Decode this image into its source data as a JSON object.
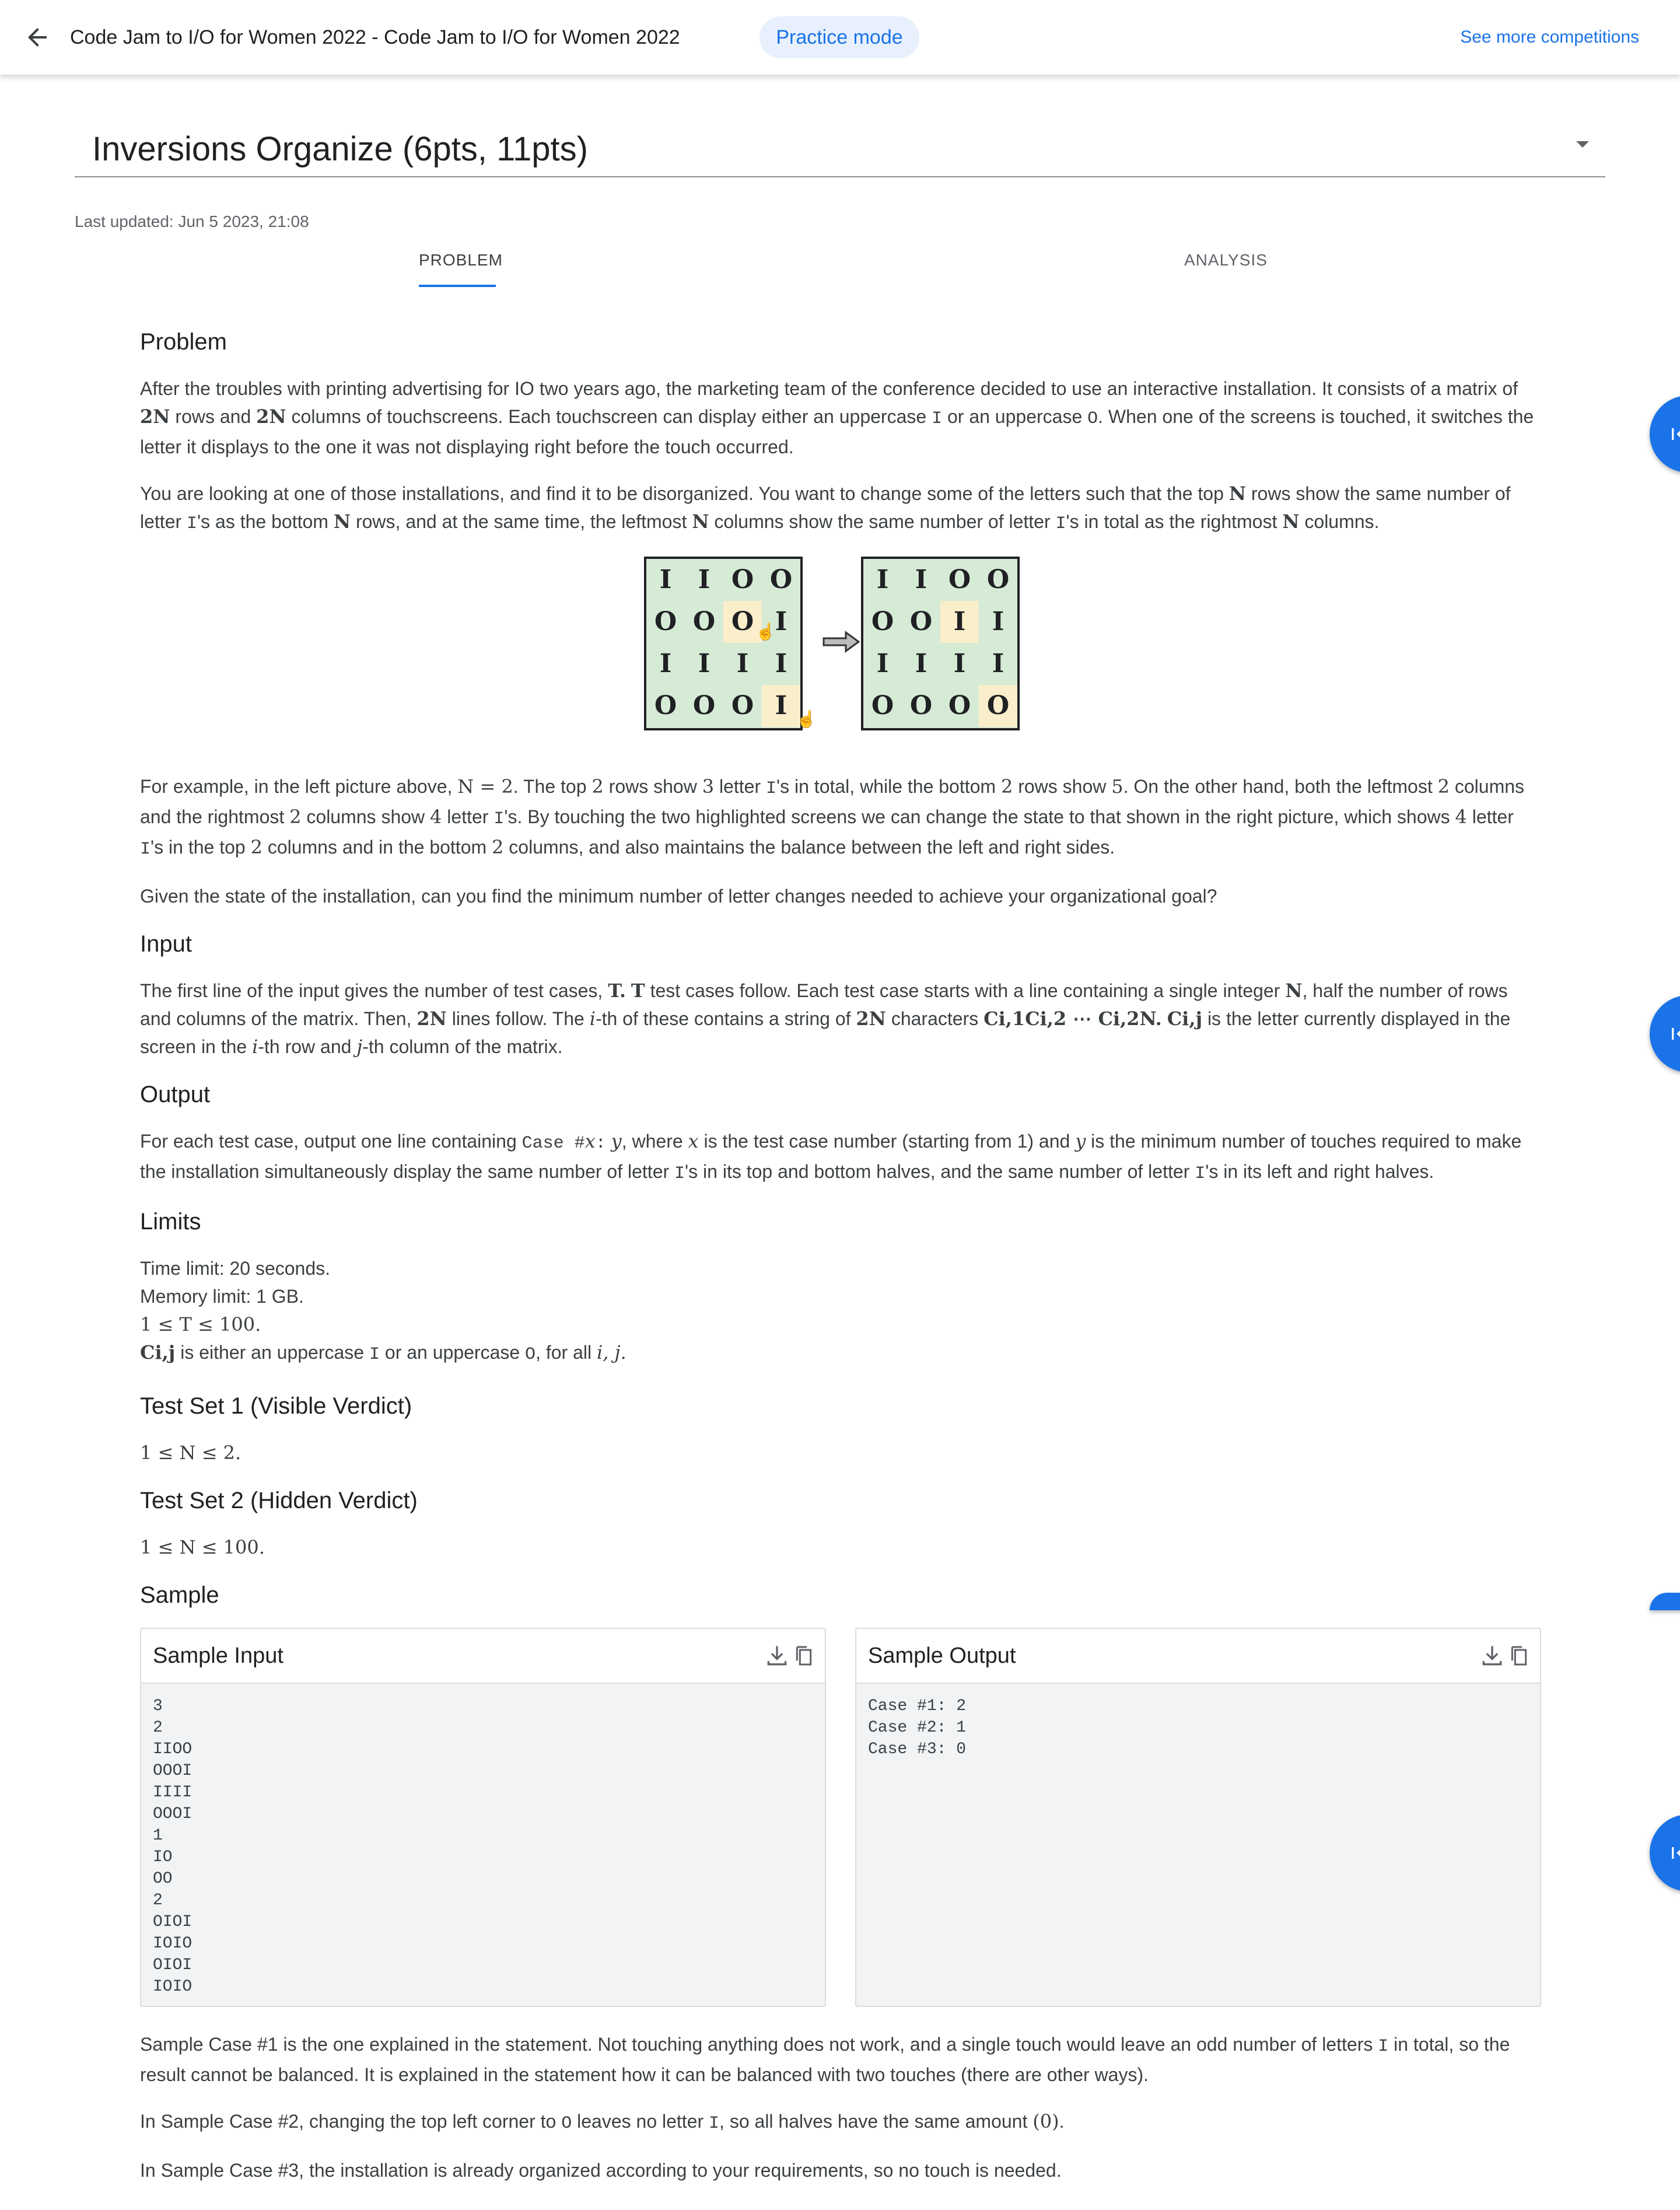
{
  "topbar": {
    "title": "Code Jam to I/O for Women 2022 - Code Jam to I/O for Women 2022",
    "mode_pill": "Practice mode",
    "see_more": "See more competitions"
  },
  "problem_selector": {
    "value": "Inversions Organize (6pts, 11pts)"
  },
  "last_updated": "Last updated: Jun 5 2023, 21:08",
  "tabs": [
    {
      "label": "PROBLEM",
      "active": true
    },
    {
      "label": "ANALYSIS",
      "active": false
    }
  ],
  "sections": {
    "problem_heading": "Problem",
    "input_heading": "Input",
    "output_heading": "Output",
    "limits_heading": "Limits",
    "ts1_heading": "Test Set 1 (Visible Verdict)",
    "ts2_heading": "Test Set 2 (Hidden Verdict)",
    "sample_heading": "Sample"
  },
  "problem_text": {
    "p1a": "After the troubles with printing advertising for IO two years ago, the marketing team of the conference decided to use an interactive installation. It consists of a matrix of ",
    "p1b": " rows and ",
    "p1c": " columns of touchscreens. Each touchscreen can display either an uppercase ",
    "p1d": " or an uppercase ",
    "p1e": ". When one of the screens is touched, it switches the letter it displays to the one it was not displaying right before the touch occurred.",
    "p2a": "You are looking at one of those installations, and find it to be disorganized. You want to change some of the letters such that the top ",
    "p2b": " rows show the same number of letter ",
    "p2c": "'s as the bottom ",
    "p2d": " rows, and at the same time, the leftmost ",
    "p2e": " columns show the same number of letter ",
    "p2f": "'s in total as the rightmost ",
    "p2g": " columns.",
    "p3a": "For example, in the left picture above, ",
    "p3b": ". The top ",
    "p3c": " rows show ",
    "p3d": " letter ",
    "p3e": "'s in total, while the bottom ",
    "p3f": " rows show ",
    "p3g": ". On the other hand, both the leftmost ",
    "p3h": " columns and the rightmost ",
    "p3i": " columns show ",
    "p3j": " letter ",
    "p3k": "'s. By touching the two highlighted screens we can change the state to that shown in the right picture, which shows ",
    "p3l": " letter ",
    "p3m": "'s in the top ",
    "p3n": " columns and in the bottom ",
    "p3o": " columns, and also maintains the balance between the left and right sides.",
    "p4": "Given the state of the installation, can you find the minimum number of letter changes needed to achieve your organizational goal?"
  },
  "math": {
    "two_n": "2N",
    "n": "N",
    "n_eq_2": "N = 2",
    "two": "2",
    "three": "3",
    "four": "4",
    "five": "5",
    "t": "T",
    "t_dot": "T.",
    "ci1": "C",
    "row_chars": "Ci,1Ci,2 ⋯ Ci,2N.",
    "cij": "Ci,j",
    "i": "i",
    "j": "j",
    "ij": "i, j.",
    "x": "x",
    "y": "y",
    "zero": "(0)",
    "t_range": "1 ≤ T ≤ 100.",
    "n_range1": "1 ≤ N ≤ 2.",
    "n_range2": "1 ≤ N ≤ 100."
  },
  "mono": {
    "I": "I",
    "O": "O",
    "case_fmt": "Case #",
    "colon": ":"
  },
  "input_text": {
    "a": "The first line of the input gives the number of test cases, ",
    "b": " test cases follow. Each test case starts with a line containing a single integer ",
    "c": ", half the number of rows and columns of the matrix. Then, ",
    "d": " lines follow. The ",
    "e": "-th of these contains a string of ",
    "f": " characters ",
    "g": " is the letter currently displayed in the screen in the ",
    "h": "-th row and ",
    "k": "-th column of the matrix."
  },
  "output_text": {
    "a": "For each test case, output one line containing ",
    "b": ", where ",
    "c": " is the test case number (starting from 1) and ",
    "d": " is the minimum number of touches required to make the installation simultaneously display the same number of letter ",
    "e": "'s in its top and bottom halves, and the same number of letter ",
    "f": "'s in its left and right halves."
  },
  "limits": {
    "time": "Time limit: 20 seconds.",
    "memory": "Memory limit: 1 GB.",
    "cij_a": " is either an uppercase ",
    "cij_b": " or an uppercase ",
    "cij_c": ", for all "
  },
  "figure": {
    "left": [
      [
        "I",
        "I",
        "O",
        "O"
      ],
      [
        "O",
        "O",
        "O",
        "I"
      ],
      [
        "I",
        "I",
        "I",
        "I"
      ],
      [
        "O",
        "O",
        "O",
        "I"
      ]
    ],
    "right": [
      [
        "I",
        "I",
        "O",
        "O"
      ],
      [
        "O",
        "O",
        "I",
        "I"
      ],
      [
        "I",
        "I",
        "I",
        "I"
      ],
      [
        "O",
        "O",
        "O",
        "O"
      ]
    ],
    "highlight": [
      [
        1,
        2
      ],
      [
        3,
        3
      ]
    ],
    "colors": {
      "cell_bg": "#d6ebd6",
      "highlight_bg": "#fbeecb"
    }
  },
  "samples": {
    "input_title": "Sample Input",
    "output_title": "Sample Output",
    "input_text": "3\n2\nIIOO\nOOOI\nIIII\nOOOI\n1\nIO\nOO\n2\nOIOI\nIOIO\nOIOI\nIOIO",
    "output_text": "Case #1: 2\nCase #2: 1\nCase #3: 0"
  },
  "sample_explain": {
    "c1a": "Sample Case #1 is the one explained in the statement. Not touching anything does not work, and a single touch would leave an odd number of letters ",
    "c1b": " in total, so the result cannot be balanced. It is explained in the statement how it can be balanced with two touches (there are other ways).",
    "c2a": "In Sample Case #2, changing the top left corner to ",
    "c2b": " leaves no letter ",
    "c2c": ", so all halves have the same amount ",
    "c2d": ".",
    "c3": "In Sample Case #3, the installation is already organized according to your requirements, so no touch is needed."
  },
  "icons": [
    "arrow-back-icon",
    "dropdown-caret-icon",
    "download-icon",
    "copy-icon",
    "first-page-icon",
    "pointer-hand-icon",
    "right-arrow-icon"
  ],
  "accent_color": "#1a73e8"
}
